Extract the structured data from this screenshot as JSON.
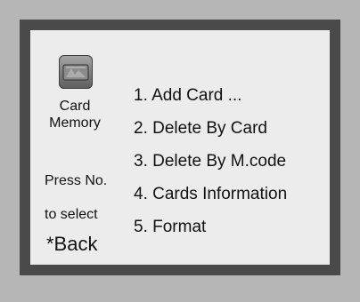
{
  "screen": {
    "icon": "card-memory-icon",
    "title_line1": "Card",
    "title_line2": "Memory",
    "hint_line1": "Press No.",
    "hint_line2": "to select",
    "back_label": "*Back"
  },
  "menu": {
    "items": [
      {
        "label": "1. Add Card ..."
      },
      {
        "label": "2. Delete By Card"
      },
      {
        "label": "3. Delete By M.code"
      },
      {
        "label": "4. Cards Information"
      },
      {
        "label": "5. Format"
      }
    ]
  },
  "colors": {
    "frame": "#4a4a4a",
    "screen_bg": "#ececec",
    "device_bg": "#b6b6b6"
  }
}
